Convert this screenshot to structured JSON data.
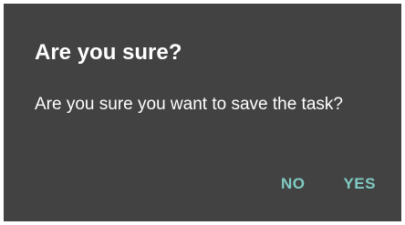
{
  "dialog": {
    "title": "Are you sure?",
    "message": "Are you sure you want to save the task?",
    "buttons": {
      "no": "NO",
      "yes": "YES"
    }
  },
  "colors": {
    "background": "#424242",
    "text": "#ffffff",
    "accent": "#80cbc4"
  }
}
